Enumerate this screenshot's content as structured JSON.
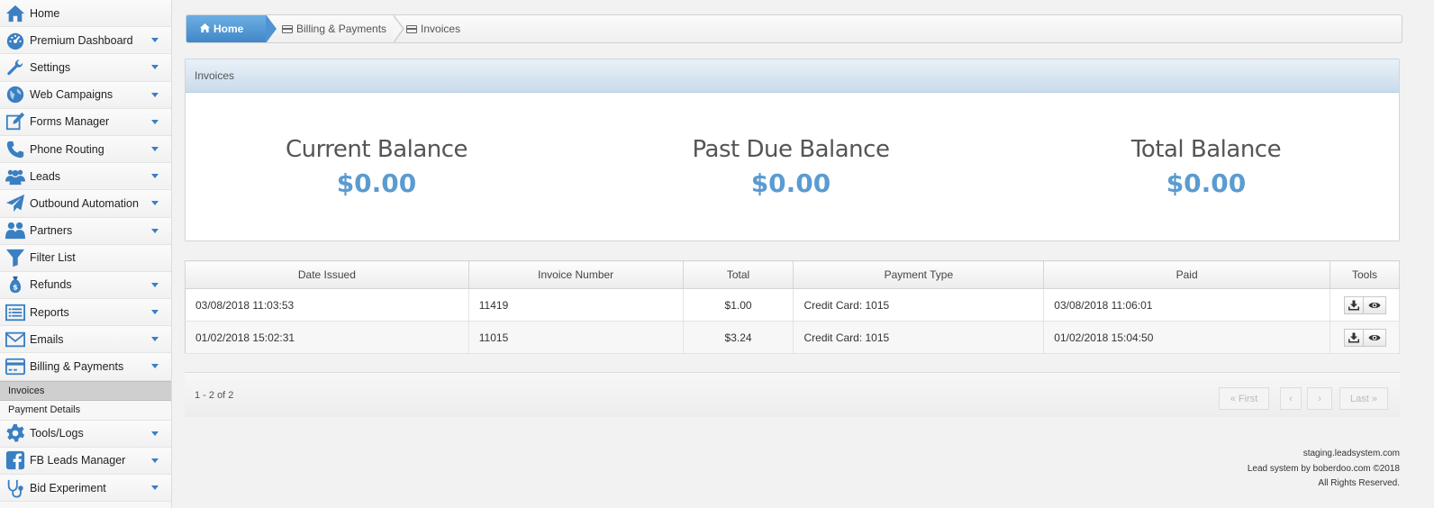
{
  "sidebar": {
    "items": [
      {
        "label": "Home",
        "icon": "home-icon",
        "caret": false
      },
      {
        "label": "Premium Dashboard",
        "icon": "dashboard-icon",
        "caret": true
      },
      {
        "label": "Settings",
        "icon": "wrench-icon",
        "caret": true
      },
      {
        "label": "Web Campaigns",
        "icon": "globe-icon",
        "caret": true
      },
      {
        "label": "Forms Manager",
        "icon": "edit-icon",
        "caret": true
      },
      {
        "label": "Phone Routing",
        "icon": "phone-icon",
        "caret": true
      },
      {
        "label": "Leads",
        "icon": "users-icon",
        "caret": true
      },
      {
        "label": "Outbound Automation",
        "icon": "paper-plane-icon",
        "caret": true
      },
      {
        "label": "Partners",
        "icon": "partners-icon",
        "caret": true
      },
      {
        "label": "Filter List",
        "icon": "filter-icon",
        "caret": false
      },
      {
        "label": "Refunds",
        "icon": "money-bag-icon",
        "caret": true
      },
      {
        "label": "Reports",
        "icon": "list-icon",
        "caret": true
      },
      {
        "label": "Emails",
        "icon": "envelope-icon",
        "caret": true
      },
      {
        "label": "Billing & Payments",
        "icon": "credit-card-icon",
        "caret": true
      }
    ],
    "sub_items": [
      {
        "label": "Invoices",
        "active": true
      },
      {
        "label": "Payment Details",
        "active": false
      }
    ],
    "items_after": [
      {
        "label": "Tools/Logs",
        "icon": "gear-icon",
        "caret": true
      },
      {
        "label": "FB Leads Manager",
        "icon": "facebook-icon",
        "caret": true
      },
      {
        "label": "Bid Experiment",
        "icon": "stethoscope-icon",
        "caret": true
      }
    ]
  },
  "breadcrumb": {
    "home": "Home",
    "items": [
      "Billing & Payments",
      "Invoices"
    ]
  },
  "balance_panel": {
    "title": "Invoices",
    "balances": [
      {
        "label": "Current Balance",
        "value": "$0.00"
      },
      {
        "label": "Past Due Balance",
        "value": "$0.00"
      },
      {
        "label": "Total Balance",
        "value": "$0.00"
      }
    ]
  },
  "table": {
    "columns": [
      "Date Issued",
      "Invoice Number",
      "Total",
      "Payment Type",
      "Paid",
      "Tools"
    ],
    "rows": [
      {
        "date_issued": "03/08/2018 11:03:53",
        "invoice_number": "11419",
        "total": "$1.00",
        "payment_type": "Credit Card: 1015",
        "paid": "03/08/2018 11:06:01"
      },
      {
        "date_issued": "01/02/2018 15:02:31",
        "invoice_number": "11015",
        "total": "$3.24",
        "payment_type": "Credit Card: 1015",
        "paid": "01/02/2018 15:04:50"
      }
    ]
  },
  "pager": {
    "info": "1 - 2 of 2",
    "first": "« First",
    "prev": "‹",
    "next": "›",
    "last": "Last »"
  },
  "footer": {
    "host": "staging.leadsystem.com",
    "credit": "Lead system by boberdoo.com ©2018",
    "rights": "All Rights Reserved."
  },
  "colors": {
    "accent": "#3e86c8",
    "balance_value": "#5b9bd0"
  }
}
